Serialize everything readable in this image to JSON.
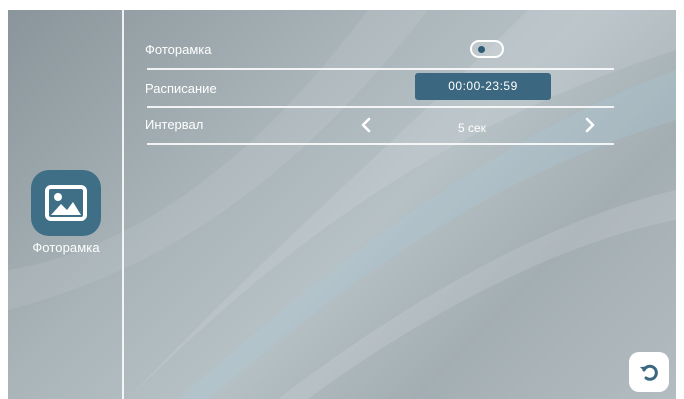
{
  "sidebar": {
    "app_label": "Фоторамка",
    "app_icon": "picture-icon"
  },
  "settings": {
    "photoframe": {
      "label": "Фоторамка",
      "toggle_on": false
    },
    "schedule": {
      "label": "Расписание",
      "value": "00:00-23:59"
    },
    "interval": {
      "label": "Интервал",
      "value": "5 сек",
      "prev_icon": "chevron-left-icon",
      "next_icon": "chevron-right-icon"
    }
  },
  "footer": {
    "back_icon": "undo-arrow-icon"
  },
  "colors": {
    "accent": "#3b6880",
    "icon_bg": "#3f6f86",
    "text": "#ffffff"
  }
}
